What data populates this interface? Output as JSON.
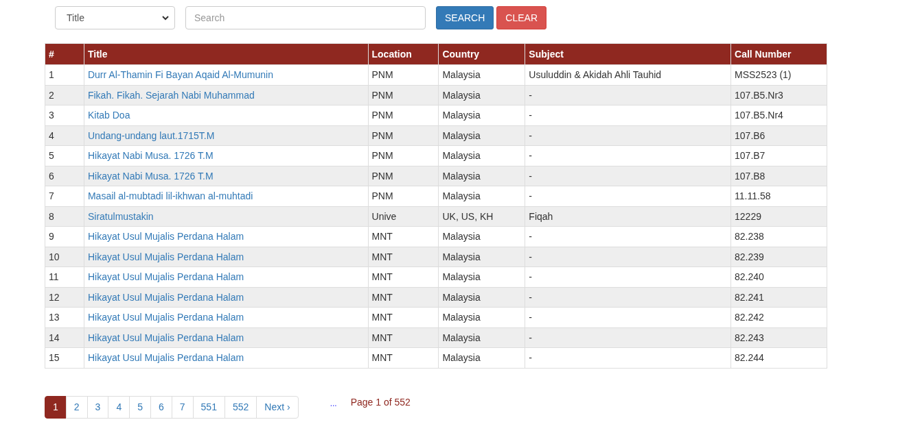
{
  "search_bar": {
    "field_select": "Title",
    "search": {
      "placeholder": "Search"
    },
    "buttons": [
      {
        "label": "SEARCH",
        "kind": "primary"
      },
      {
        "label": "CLEAR",
        "kind": "danger"
      }
    ]
  },
  "table": {
    "columns": [
      "#",
      "Title",
      "Location",
      "Country",
      "Subject",
      "Call Number"
    ],
    "rows": [
      [
        "1",
        "Durr Al-Thamin Fi Bayan Aqaid Al-Mumunin",
        "PNM",
        "Malaysia",
        "Usuluddin & Akidah Ahli Tauhid",
        "MSS2523 (1)"
      ],
      [
        "2",
        "Fikah. Fikah. Sejarah Nabi Muhammad",
        "PNM",
        "Malaysia",
        "-",
        "107.B5.Nr3"
      ],
      [
        "3",
        "Kitab Doa",
        "PNM",
        "Malaysia",
        "-",
        "107.B5.Nr4"
      ],
      [
        "4",
        "Undang-undang laut.1715T.M",
        "PNM",
        "Malaysia",
        "-",
        "107.B6"
      ],
      [
        "5",
        "Hikayat Nabi Musa. 1726 T.M",
        "PNM",
        "Malaysia",
        "-",
        "107.B7"
      ],
      [
        "6",
        "Hikayat Nabi Musa. 1726 T.M",
        "PNM",
        "Malaysia",
        "-",
        "107.B8"
      ],
      [
        "7",
        "Masail al-mubtadi lil-ikhwan al-muhtadi",
        "PNM",
        "Malaysia",
        "-",
        "11.11.58"
      ],
      [
        "8",
        "Siratulmustakin",
        "Unive",
        "UK, US, KH",
        "Fiqah",
        "12229"
      ],
      [
        "9",
        "Hikayat Usul Mujalis Perdana Halam",
        "MNT",
        "Malaysia",
        "-",
        "82.238"
      ],
      [
        "10",
        "Hikayat Usul Mujalis Perdana Halam",
        "MNT",
        "Malaysia",
        "-",
        "82.239"
      ],
      [
        "11",
        "Hikayat Usul Mujalis Perdana Halam",
        "MNT",
        "Malaysia",
        "-",
        "82.240"
      ],
      [
        "12",
        "Hikayat Usul Mujalis Perdana Halam",
        "MNT",
        "Malaysia",
        "-",
        "82.241"
      ],
      [
        "13",
        "Hikayat Usul Mujalis Perdana Halam",
        "MNT",
        "Malaysia",
        "-",
        "82.242"
      ],
      [
        "14",
        "Hikayat Usul Mujalis Perdana Halam",
        "MNT",
        "Malaysia",
        "-",
        "82.243"
      ],
      [
        "15",
        "Hikayat Usul Mujalis Perdana Halam",
        "MNT",
        "Malaysia",
        "-",
        "82.244"
      ]
    ]
  },
  "pagination": {
    "pages": [
      {
        "label": "1",
        "selected": true
      },
      {
        "label": "2",
        "selected": false
      },
      {
        "label": "3",
        "selected": false
      },
      {
        "label": "4",
        "selected": false
      },
      {
        "label": "5",
        "selected": false
      },
      {
        "label": "6",
        "selected": false
      },
      {
        "label": "7",
        "selected": false
      },
      {
        "label": "551",
        "selected": false
      },
      {
        "label": "552",
        "selected": false
      },
      {
        "label": "Next ›",
        "selected": false
      }
    ],
    "ellipsis": "...",
    "page_info": "Page 1 of 552"
  }
}
